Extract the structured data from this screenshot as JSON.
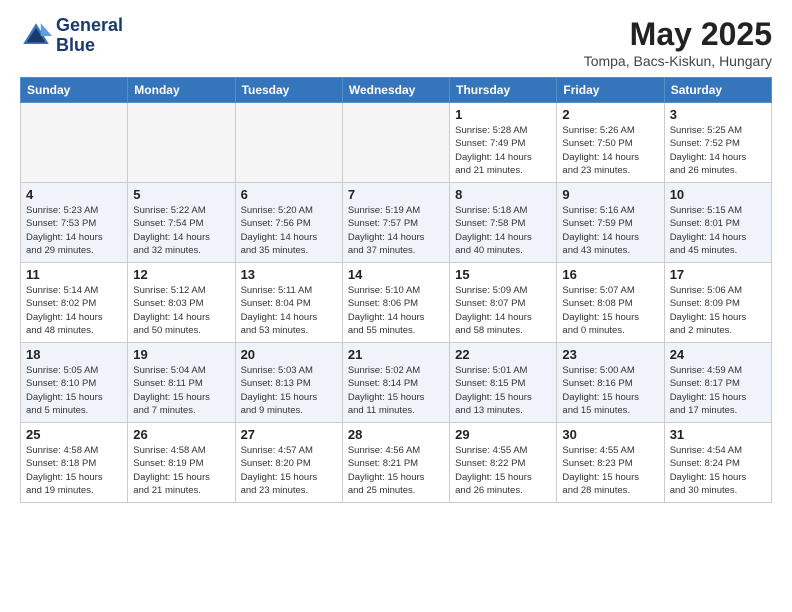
{
  "header": {
    "logo_line1": "General",
    "logo_line2": "Blue",
    "month": "May 2025",
    "location": "Tompa, Bacs-Kiskun, Hungary"
  },
  "weekdays": [
    "Sunday",
    "Monday",
    "Tuesday",
    "Wednesday",
    "Thursday",
    "Friday",
    "Saturday"
  ],
  "weeks": [
    [
      {
        "day": "",
        "info": ""
      },
      {
        "day": "",
        "info": ""
      },
      {
        "day": "",
        "info": ""
      },
      {
        "day": "",
        "info": ""
      },
      {
        "day": "1",
        "info": "Sunrise: 5:28 AM\nSunset: 7:49 PM\nDaylight: 14 hours\nand 21 minutes."
      },
      {
        "day": "2",
        "info": "Sunrise: 5:26 AM\nSunset: 7:50 PM\nDaylight: 14 hours\nand 23 minutes."
      },
      {
        "day": "3",
        "info": "Sunrise: 5:25 AM\nSunset: 7:52 PM\nDaylight: 14 hours\nand 26 minutes."
      }
    ],
    [
      {
        "day": "4",
        "info": "Sunrise: 5:23 AM\nSunset: 7:53 PM\nDaylight: 14 hours\nand 29 minutes."
      },
      {
        "day": "5",
        "info": "Sunrise: 5:22 AM\nSunset: 7:54 PM\nDaylight: 14 hours\nand 32 minutes."
      },
      {
        "day": "6",
        "info": "Sunrise: 5:20 AM\nSunset: 7:56 PM\nDaylight: 14 hours\nand 35 minutes."
      },
      {
        "day": "7",
        "info": "Sunrise: 5:19 AM\nSunset: 7:57 PM\nDaylight: 14 hours\nand 37 minutes."
      },
      {
        "day": "8",
        "info": "Sunrise: 5:18 AM\nSunset: 7:58 PM\nDaylight: 14 hours\nand 40 minutes."
      },
      {
        "day": "9",
        "info": "Sunrise: 5:16 AM\nSunset: 7:59 PM\nDaylight: 14 hours\nand 43 minutes."
      },
      {
        "day": "10",
        "info": "Sunrise: 5:15 AM\nSunset: 8:01 PM\nDaylight: 14 hours\nand 45 minutes."
      }
    ],
    [
      {
        "day": "11",
        "info": "Sunrise: 5:14 AM\nSunset: 8:02 PM\nDaylight: 14 hours\nand 48 minutes."
      },
      {
        "day": "12",
        "info": "Sunrise: 5:12 AM\nSunset: 8:03 PM\nDaylight: 14 hours\nand 50 minutes."
      },
      {
        "day": "13",
        "info": "Sunrise: 5:11 AM\nSunset: 8:04 PM\nDaylight: 14 hours\nand 53 minutes."
      },
      {
        "day": "14",
        "info": "Sunrise: 5:10 AM\nSunset: 8:06 PM\nDaylight: 14 hours\nand 55 minutes."
      },
      {
        "day": "15",
        "info": "Sunrise: 5:09 AM\nSunset: 8:07 PM\nDaylight: 14 hours\nand 58 minutes."
      },
      {
        "day": "16",
        "info": "Sunrise: 5:07 AM\nSunset: 8:08 PM\nDaylight: 15 hours\nand 0 minutes."
      },
      {
        "day": "17",
        "info": "Sunrise: 5:06 AM\nSunset: 8:09 PM\nDaylight: 15 hours\nand 2 minutes."
      }
    ],
    [
      {
        "day": "18",
        "info": "Sunrise: 5:05 AM\nSunset: 8:10 PM\nDaylight: 15 hours\nand 5 minutes."
      },
      {
        "day": "19",
        "info": "Sunrise: 5:04 AM\nSunset: 8:11 PM\nDaylight: 15 hours\nand 7 minutes."
      },
      {
        "day": "20",
        "info": "Sunrise: 5:03 AM\nSunset: 8:13 PM\nDaylight: 15 hours\nand 9 minutes."
      },
      {
        "day": "21",
        "info": "Sunrise: 5:02 AM\nSunset: 8:14 PM\nDaylight: 15 hours\nand 11 minutes."
      },
      {
        "day": "22",
        "info": "Sunrise: 5:01 AM\nSunset: 8:15 PM\nDaylight: 15 hours\nand 13 minutes."
      },
      {
        "day": "23",
        "info": "Sunrise: 5:00 AM\nSunset: 8:16 PM\nDaylight: 15 hours\nand 15 minutes."
      },
      {
        "day": "24",
        "info": "Sunrise: 4:59 AM\nSunset: 8:17 PM\nDaylight: 15 hours\nand 17 minutes."
      }
    ],
    [
      {
        "day": "25",
        "info": "Sunrise: 4:58 AM\nSunset: 8:18 PM\nDaylight: 15 hours\nand 19 minutes."
      },
      {
        "day": "26",
        "info": "Sunrise: 4:58 AM\nSunset: 8:19 PM\nDaylight: 15 hours\nand 21 minutes."
      },
      {
        "day": "27",
        "info": "Sunrise: 4:57 AM\nSunset: 8:20 PM\nDaylight: 15 hours\nand 23 minutes."
      },
      {
        "day": "28",
        "info": "Sunrise: 4:56 AM\nSunset: 8:21 PM\nDaylight: 15 hours\nand 25 minutes."
      },
      {
        "day": "29",
        "info": "Sunrise: 4:55 AM\nSunset: 8:22 PM\nDaylight: 15 hours\nand 26 minutes."
      },
      {
        "day": "30",
        "info": "Sunrise: 4:55 AM\nSunset: 8:23 PM\nDaylight: 15 hours\nand 28 minutes."
      },
      {
        "day": "31",
        "info": "Sunrise: 4:54 AM\nSunset: 8:24 PM\nDaylight: 15 hours\nand 30 minutes."
      }
    ]
  ]
}
